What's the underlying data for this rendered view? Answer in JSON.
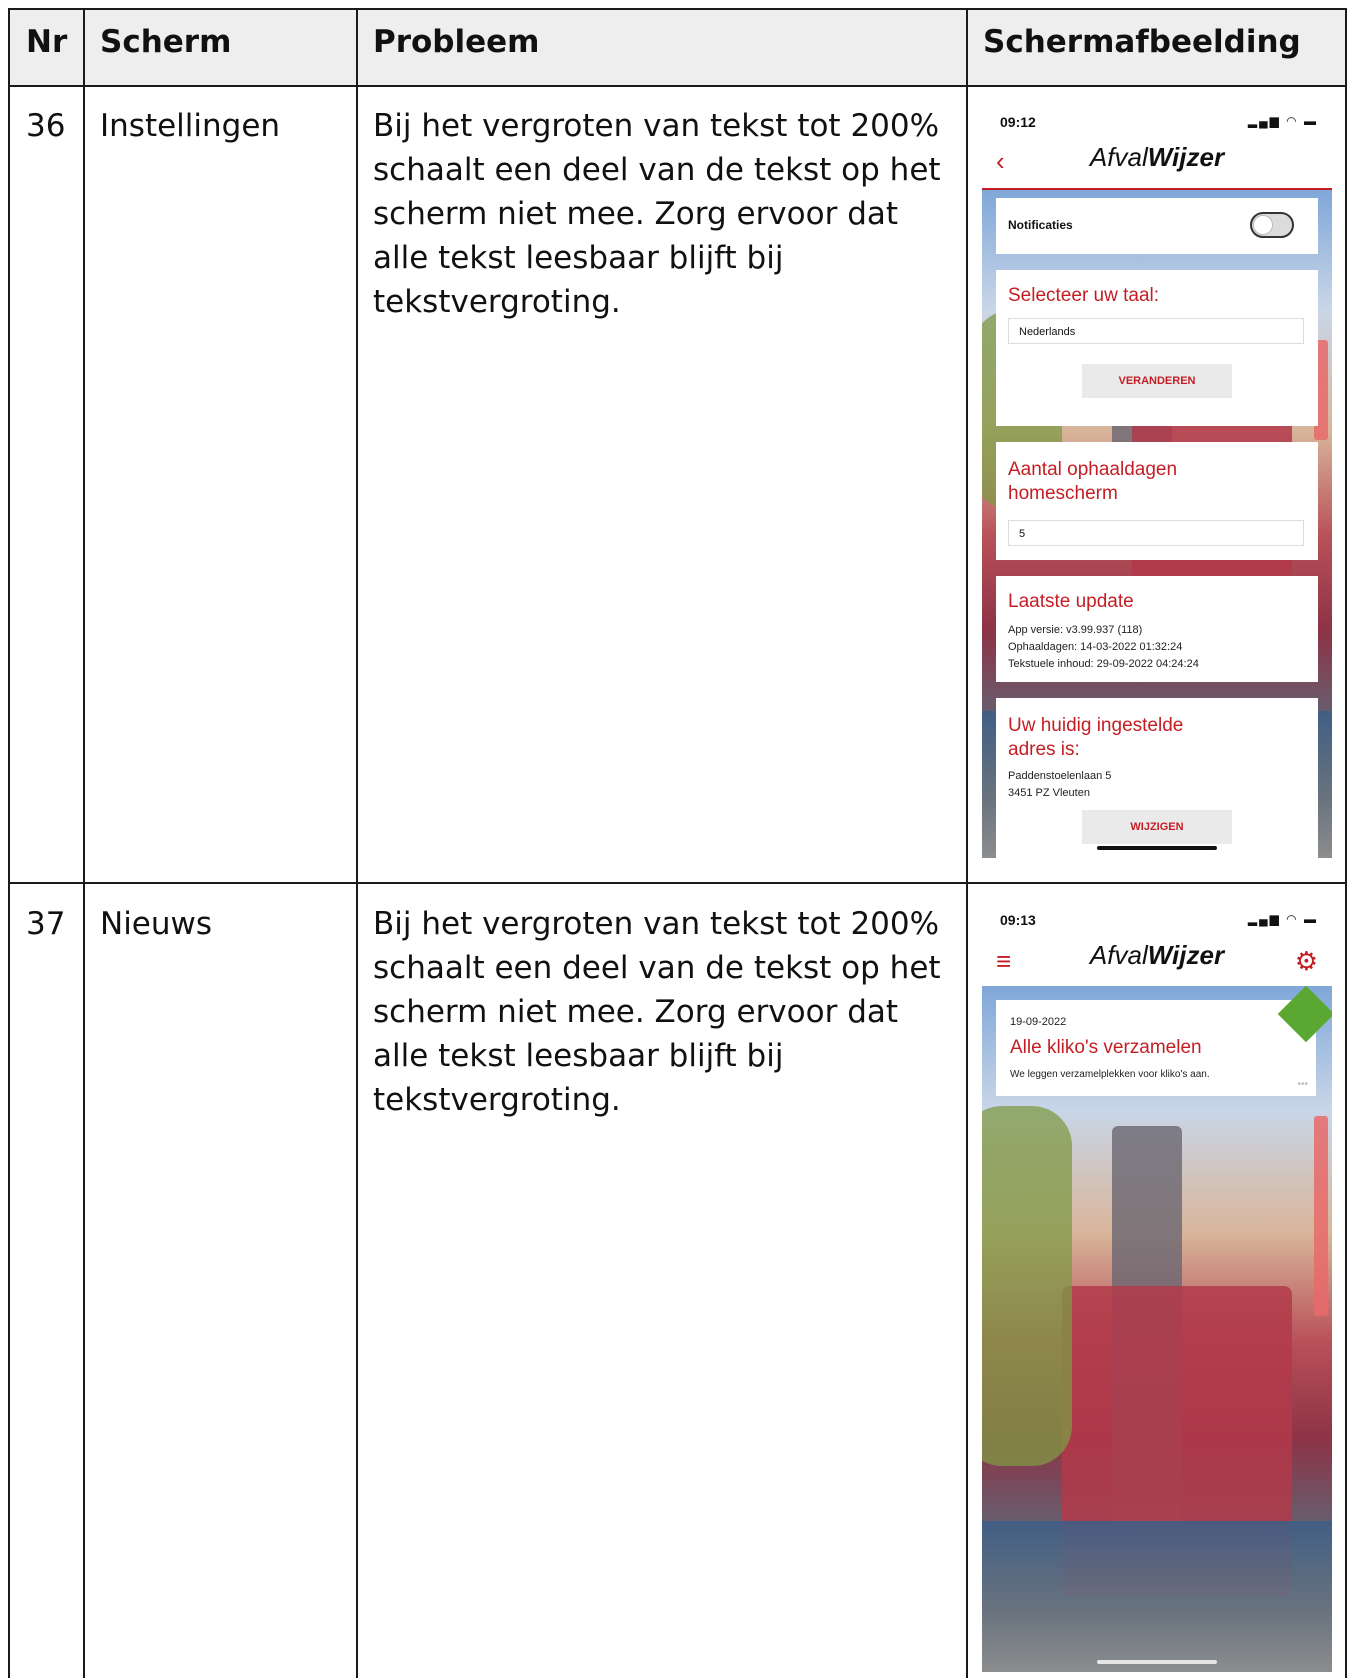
{
  "table": {
    "headers": {
      "nr": "Nr",
      "scherm": "Scherm",
      "probleem": "Probleem",
      "schermafbeelding": "Schermafbeelding"
    },
    "rows": [
      {
        "nr": "36",
        "scherm": "Instellingen",
        "probleem": "Bij het vergroten van tekst tot 200% schaalt een deel van de tekst op het scherm niet mee. Zorg ervoor dat alle tekst leesbaar blijft bij tekstvergroting.",
        "screenshot": {
          "time": "09:12",
          "logo_light": "Afval",
          "logo_bold": "Wijzer",
          "notifications_label": "Notificaties",
          "language_title": "Selecteer uw taal:",
          "language_value": "Nederlands",
          "change_button": "VERANDEREN",
          "pickup_days_title": "Aantal ophaaldagen homescherm",
          "pickup_days_value": "5",
          "last_update_title": "Laatste update",
          "app_version": "App versie: v3.99.937 (118)",
          "pickup_dates": "Ophaaldagen: 14-03-2022 01:32:24",
          "text_content": "Tekstuele inhoud: 29-09-2022 04:24:24",
          "address_title": "Uw huidig ingestelde adres is:",
          "address_line1": "Paddenstoelenlaan 5",
          "address_line2": "3451 PZ Vleuten",
          "edit_button": "WIJZIGEN"
        }
      },
      {
        "nr": "37",
        "scherm": "Nieuws",
        "probleem": "Bij het vergroten van tekst tot 200% schaalt een deel van de tekst op het scherm niet mee. Zorg ervoor dat alle tekst leesbaar blijft bij tekstvergroting.",
        "screenshot": {
          "time": "09:13",
          "logo_light": "Afval",
          "logo_bold": "Wijzer",
          "news_date": "19-09-2022",
          "news_title": "Alle kliko's verzamelen",
          "news_text": "We leggen verzamelplekken voor kliko's aan."
        }
      }
    ]
  },
  "colors": {
    "accent": "#c41e24",
    "header_bg": "#eeeeee"
  }
}
